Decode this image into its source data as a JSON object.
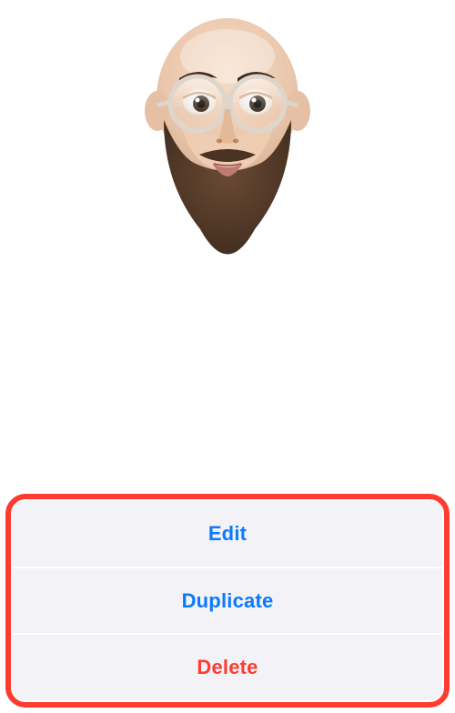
{
  "avatar": {
    "icon_name": "memoji-bearded-man-glasses"
  },
  "actionSheet": {
    "items": [
      {
        "label": "Edit",
        "style": "blue"
      },
      {
        "label": "Duplicate",
        "style": "blue"
      },
      {
        "label": "Delete",
        "style": "red"
      }
    ]
  },
  "colors": {
    "accent_blue": "#0A7AFF",
    "destructive_red": "#FF3B30",
    "sheet_bg": "#F2F2F7",
    "highlight_border": "#FF3B30"
  }
}
